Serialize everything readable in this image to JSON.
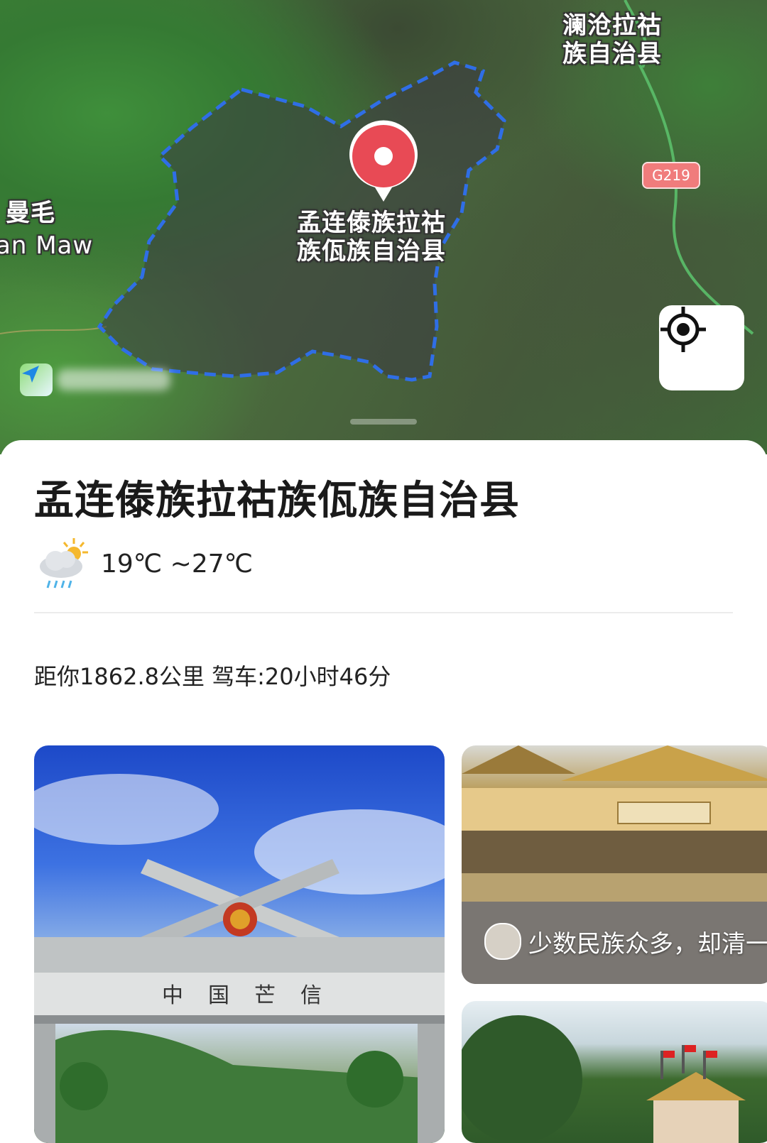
{
  "map": {
    "labels": {
      "lancang_line1": "澜沧拉祜",
      "lancang_line2": "族自治县",
      "manmao_cn": "曼毛",
      "manmao_en": "an Maw",
      "county_line1": "孟连傣族拉祜",
      "county_line2": "族佤族自治县"
    },
    "road": "G219",
    "icons": {
      "pin": "location-pin-icon",
      "locate": "my-location-icon",
      "logo": "map-app-logo-icon"
    },
    "colors": {
      "boundary": "#2f6ee6",
      "pin": "#e84a55",
      "road": "#f07c7c"
    }
  },
  "place": {
    "title": "孟连傣族拉祜族佤族自治县",
    "weather": {
      "icon": "cloud-rain-sun-icon",
      "temp": "19℃ ~27℃"
    },
    "distance": "距你1862.8公里 驾车:20小时46分"
  },
  "photos": {
    "card_b_caption": "少数民族众多，却清一"
  }
}
